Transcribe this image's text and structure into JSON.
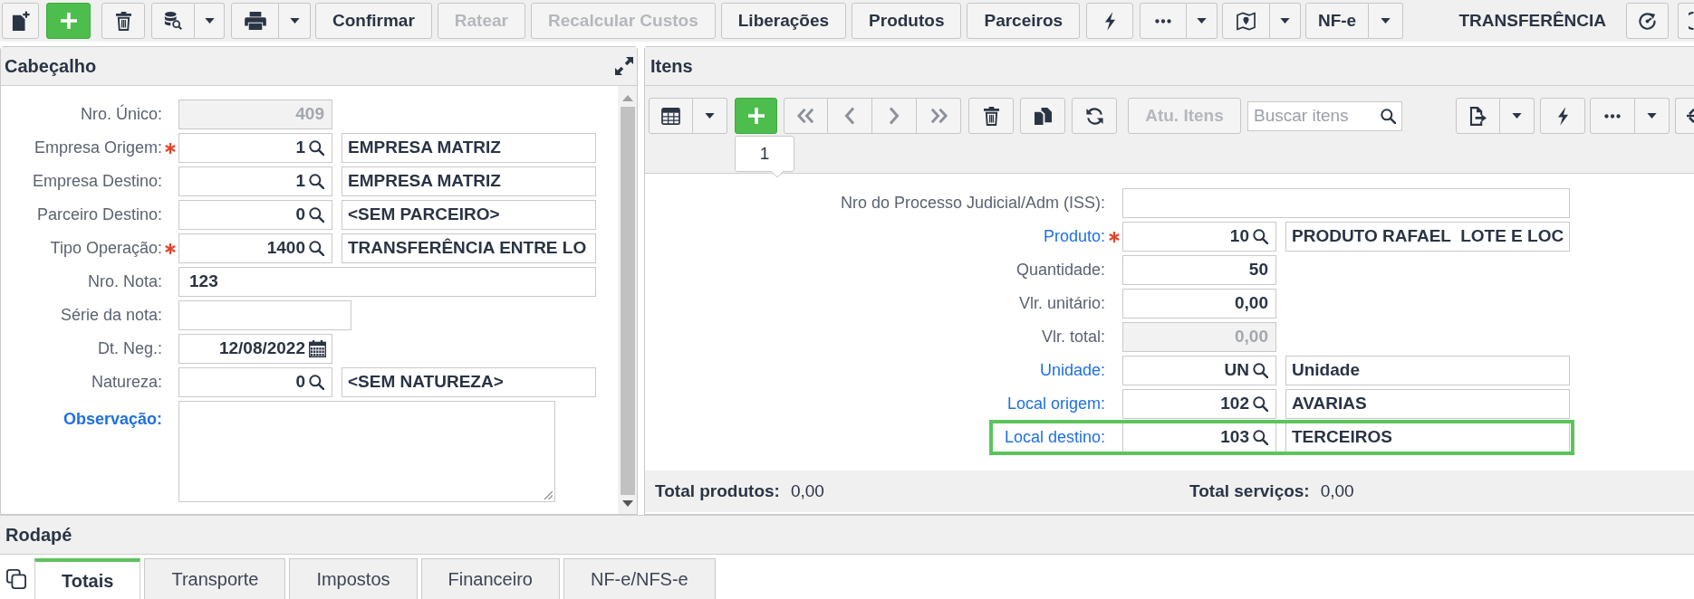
{
  "toolbar": {
    "buttons": [
      {
        "label": "Confirmar",
        "disabled": false
      },
      {
        "label": "Ratear",
        "disabled": true
      },
      {
        "label": "Recalcular Custos",
        "disabled": true
      },
      {
        "label": "Liberações",
        "disabled": false
      },
      {
        "label": "Produtos",
        "disabled": false
      },
      {
        "label": "Parceiros",
        "disabled": false
      }
    ],
    "menu_button": {
      "label": "NF-e"
    },
    "title": "TRANSFERÊNCIA"
  },
  "header_panel": {
    "title": "Cabeçalho",
    "fields": [
      {
        "label": "Nro. Único:",
        "kind": "number",
        "required": false,
        "link": false,
        "disabled": true,
        "value": "409"
      },
      {
        "label": "Empresa Origem:",
        "kind": "lookup",
        "required": true,
        "link": false,
        "disabled": false,
        "code": "1",
        "description": "EMPRESA MATRIZ"
      },
      {
        "label": "Empresa Destino:",
        "kind": "lookup",
        "required": false,
        "link": false,
        "disabled": false,
        "code": "1",
        "description": "EMPRESA MATRIZ"
      },
      {
        "label": "Parceiro Destino:",
        "kind": "lookup",
        "required": false,
        "link": false,
        "disabled": false,
        "code": "0",
        "description": "<SEM PARCEIRO>"
      },
      {
        "label": "Tipo Operação:",
        "kind": "lookup",
        "required": true,
        "link": false,
        "disabled": false,
        "code": "1400",
        "description": "TRANSFERÊNCIA ENTRE LO"
      },
      {
        "label": "Nro. Nota:",
        "kind": "text",
        "required": false,
        "link": false,
        "disabled": false,
        "value": "123"
      },
      {
        "label": "Série da nota:",
        "kind": "short",
        "required": false,
        "link": false,
        "disabled": false
      },
      {
        "label": "Dt. Neg.:",
        "kind": "date",
        "required": false,
        "link": false,
        "disabled": false,
        "value": "12/08/2022"
      },
      {
        "label": "Natureza:",
        "kind": "lookup",
        "required": false,
        "link": false,
        "disabled": false,
        "code": "0",
        "description": "<SEM NATUREZA>"
      },
      {
        "label": "Observação:",
        "kind": "textarea",
        "required": false,
        "link": true,
        "disabled": false
      }
    ]
  },
  "items_panel": {
    "title": "Itens",
    "navigation": {
      "disabled": true
    },
    "update_button": {
      "label": "Atu. Itens",
      "disabled": true
    },
    "search": {
      "placeholder": "Buscar itens"
    },
    "add_tooltip": "1",
    "fields": [
      {
        "label": "Nro do Processo Judicial/Adm (ISS):",
        "kind": "text",
        "required": false,
        "link": false,
        "disabled": false,
        "highlighted": false
      },
      {
        "label": "Produto:",
        "kind": "lookup",
        "required": true,
        "link": true,
        "disabled": false,
        "highlighted": false,
        "code": "10",
        "description": "PRODUTO RAFAEL  LOTE E LOC"
      },
      {
        "label": "Quantidade:",
        "kind": "number",
        "required": false,
        "link": false,
        "disabled": false,
        "highlighted": false,
        "value": "50"
      },
      {
        "label": "Vlr. unitário:",
        "kind": "number",
        "required": false,
        "link": false,
        "disabled": false,
        "highlighted": false,
        "value": "0,00"
      },
      {
        "label": "Vlr. total:",
        "kind": "number",
        "required": false,
        "link": false,
        "disabled": true,
        "highlighted": false,
        "value": "0,00"
      },
      {
        "label": "Unidade:",
        "kind": "lookup",
        "required": false,
        "link": true,
        "disabled": false,
        "highlighted": false,
        "code": "UN",
        "description": "Unidade"
      },
      {
        "label": "Local origem:",
        "kind": "lookup",
        "required": false,
        "link": true,
        "disabled": false,
        "highlighted": false,
        "code": "102",
        "description": "AVARIAS"
      },
      {
        "label": "Local destino:",
        "kind": "lookup",
        "required": false,
        "link": true,
        "disabled": false,
        "highlighted": true,
        "code": "103",
        "description": "TERCEIROS"
      }
    ],
    "totals": [
      {
        "label": "Total produtos:",
        "value": "0,00"
      },
      {
        "label": "Total serviços:",
        "value": "0,00"
      }
    ]
  },
  "footer_panel": {
    "title": "Rodapé",
    "tabs": [
      {
        "label": "Totais",
        "selected": true
      },
      {
        "label": "Transporte",
        "selected": false
      },
      {
        "label": "Impostos",
        "selected": false
      },
      {
        "label": "Financeiro",
        "selected": false
      },
      {
        "label": "NF-e/NFS-e",
        "selected": false
      }
    ]
  }
}
